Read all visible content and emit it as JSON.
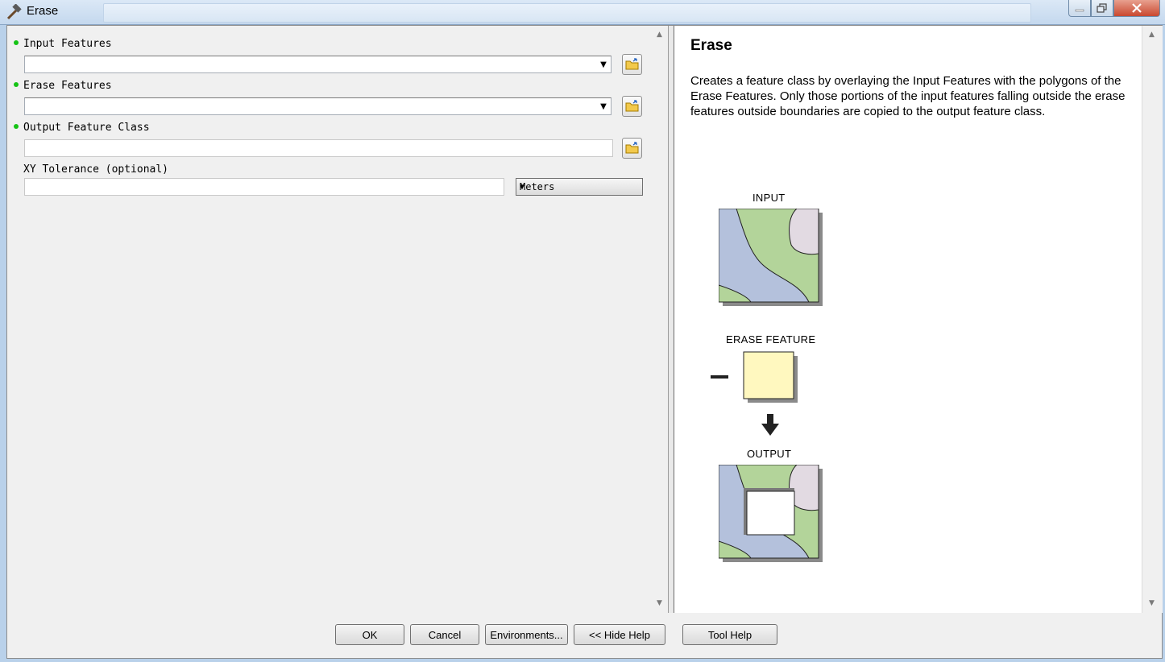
{
  "window": {
    "title": "Erase",
    "app_icon": "hammer-icon",
    "controls": {
      "minimize": "minimize-icon",
      "maximize": "maximize-icon",
      "close": "close-icon"
    }
  },
  "parameters": {
    "input_features": {
      "label": "Input Features",
      "value": "",
      "required": true
    },
    "erase_features": {
      "label": "Erase Features",
      "value": "",
      "required": true
    },
    "output_feature_class": {
      "label": "Output Feature Class",
      "value": "",
      "required": true
    },
    "xy_tolerance": {
      "label": "XY Tolerance (optional)",
      "value": "",
      "units": "Meters"
    }
  },
  "help": {
    "title": "Erase",
    "description": "Creates a feature class by overlaying the Input Features with the polygons of the Erase Features. Only those portions of the input features falling outside the erase features outside boundaries are copied to the output feature class.",
    "illustration": {
      "input_label": "INPUT",
      "erase_label": "ERASE FEATURE",
      "output_label": "OUTPUT"
    }
  },
  "buttons": {
    "ok": "OK",
    "cancel": "Cancel",
    "environments": "Environments...",
    "hide_help": "<< Hide Help",
    "tool_help": "Tool Help"
  },
  "colors": {
    "required_dot": "#15c315",
    "polygon_green": "#b3d49a",
    "polygon_blue": "#b4c1dc",
    "polygon_pink": "#e2dae2",
    "erase_yellow": "#fff8bf"
  }
}
